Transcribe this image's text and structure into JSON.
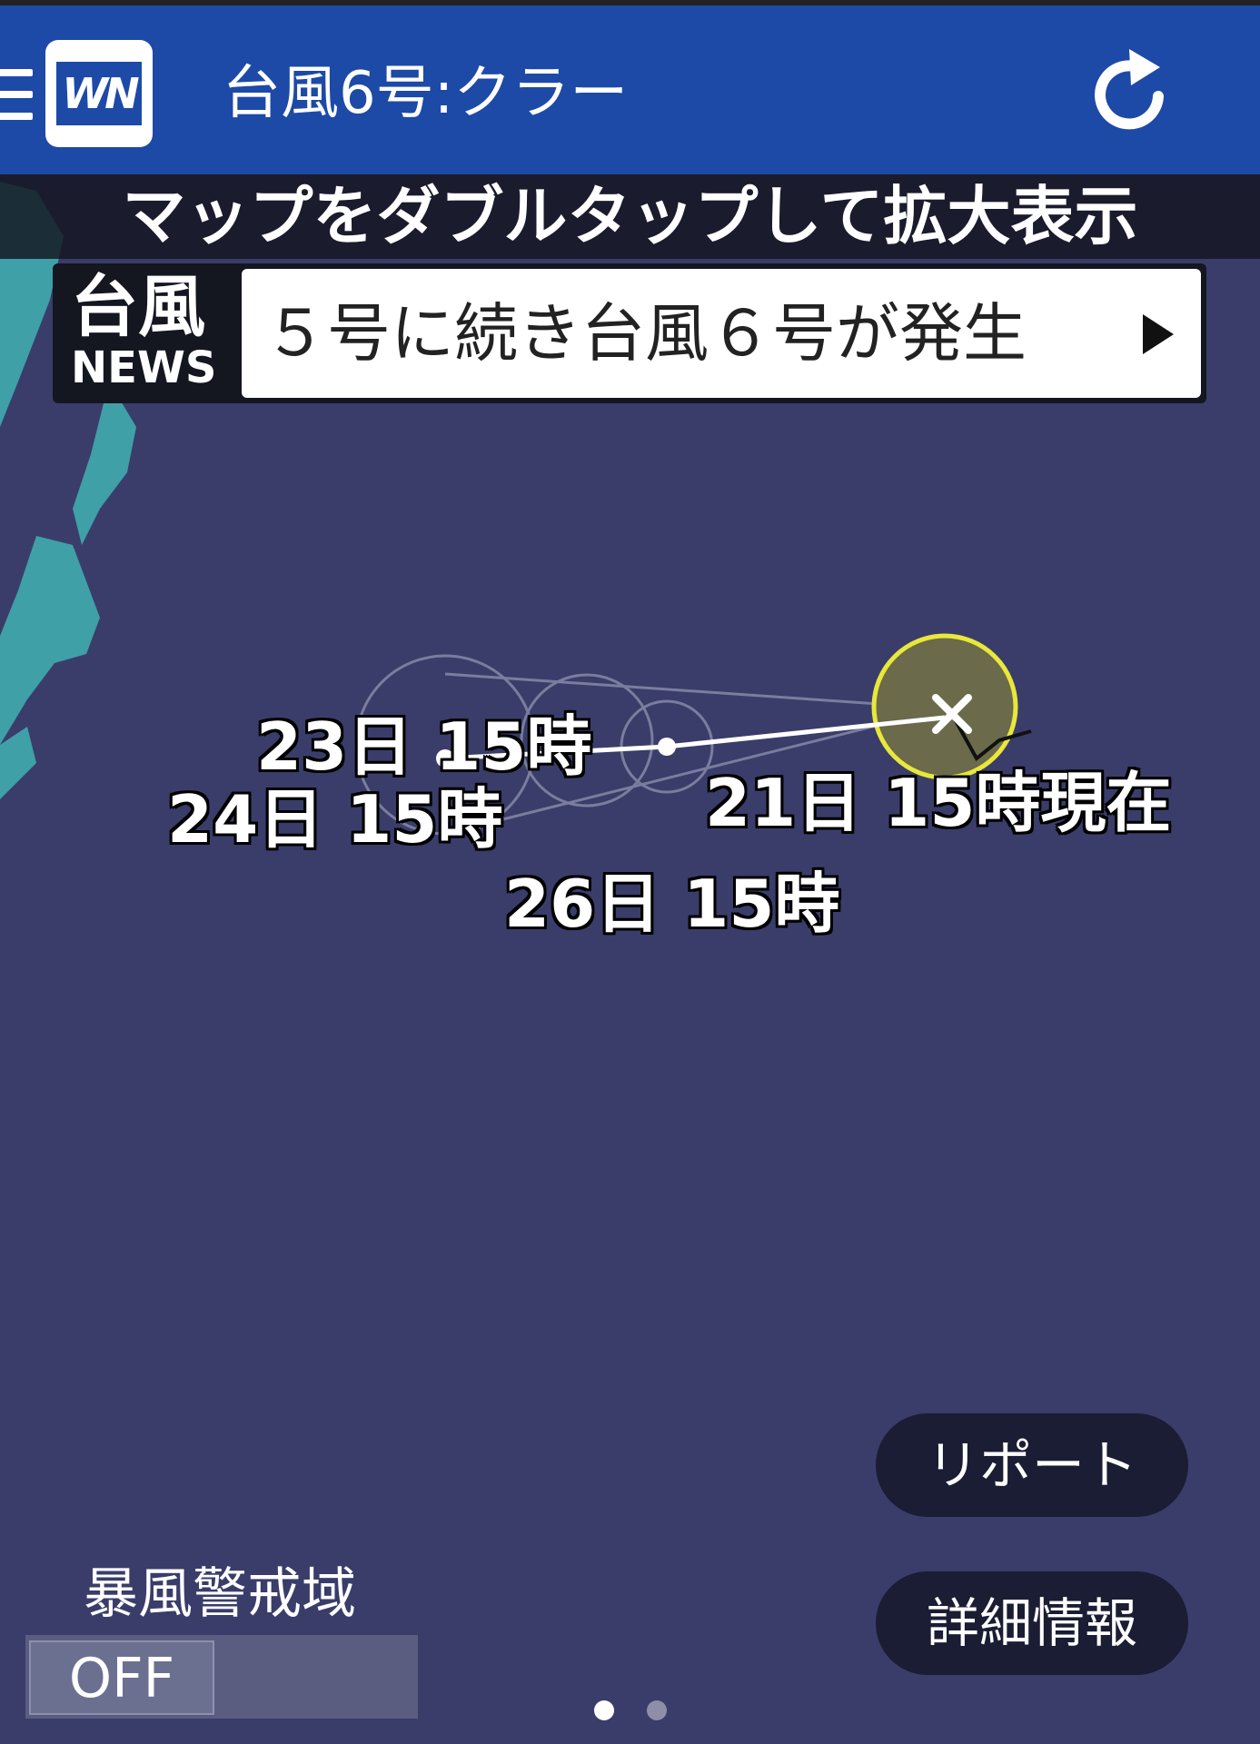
{
  "header": {
    "title": "台風6号:クラー",
    "logo_text": "WN"
  },
  "hint": "マップをダブルタップして拡大表示",
  "news": {
    "badge_top": "台風",
    "badge_bottom": "NEWS",
    "headline": "５号に続き台風６号が発生"
  },
  "forecast_labels": {
    "d23": "23日 15時",
    "d24": "24日 15時",
    "d26": "26日 15時",
    "current": "21日 15時現在"
  },
  "buttons": {
    "report": "リポート",
    "details": "詳細情報"
  },
  "storm_zone": {
    "label": "暴風警戒域",
    "toggle_value": "OFF"
  },
  "pager": {
    "count": 2,
    "active_index": 0
  },
  "colors": {
    "ocean": "#3a3d6a",
    "land": "#3fa0a8",
    "header": "#1d4aa7",
    "storm_circle": "#6b6a4a",
    "storm_ring": "#e8e83a"
  }
}
